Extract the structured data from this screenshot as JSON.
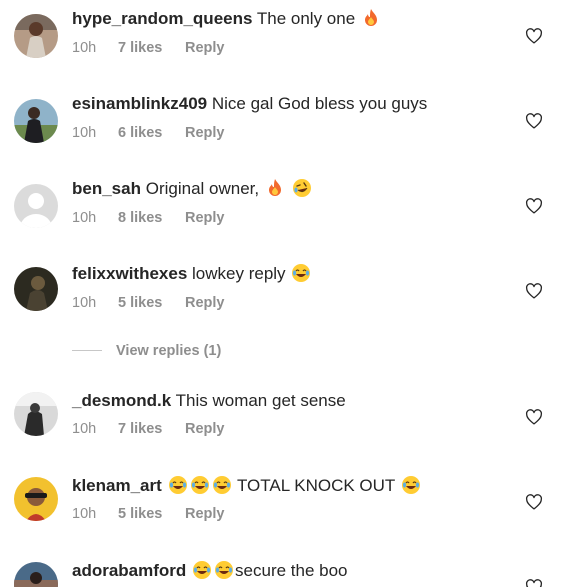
{
  "comments": [
    {
      "username": "hype_random_queens",
      "text": "The only one",
      "time": "10h",
      "likes": "7 likes",
      "reply": "Reply",
      "emojis_after": [
        "fire-emoji"
      ]
    },
    {
      "username": "esinamblinkz409",
      "text": "Nice gal God bless you guys",
      "time": "10h",
      "likes": "6 likes",
      "reply": "Reply",
      "emojis_after": []
    },
    {
      "username": "ben_sah",
      "text": "Original owner,",
      "time": "10h",
      "likes": "8 likes",
      "reply": "Reply",
      "emojis_after": [
        "fire-emoji",
        "rofl-emoji"
      ]
    },
    {
      "username": "felixxwithexes",
      "text": "lowkey reply",
      "time": "10h",
      "likes": "5 likes",
      "reply": "Reply",
      "emojis_after": [
        "joy-emoji"
      ]
    },
    {
      "username": "_desmond.k",
      "text": "This woman get sense",
      "time": "10h",
      "likes": "7 likes",
      "reply": "Reply",
      "emojis_after": []
    },
    {
      "username": "klenam_art",
      "text": "TOTAL KNOCK OUT",
      "time": "10h",
      "likes": "5 likes",
      "reply": "Reply",
      "emojis_before": [
        "joy-emoji",
        "joy-emoji",
        "joy-emoji"
      ],
      "emojis_after": [
        "joy-emoji"
      ]
    },
    {
      "username": "adorabamford",
      "text": "secure the boo",
      "emojis_before": [
        "joy-emoji",
        "joy-emoji"
      ]
    }
  ],
  "view_replies": "View replies (1)",
  "icons": {
    "like": "heart-outline-icon"
  },
  "colors": {
    "text": "#262626",
    "meta": "#8e8e8e",
    "heart": "#262626"
  }
}
